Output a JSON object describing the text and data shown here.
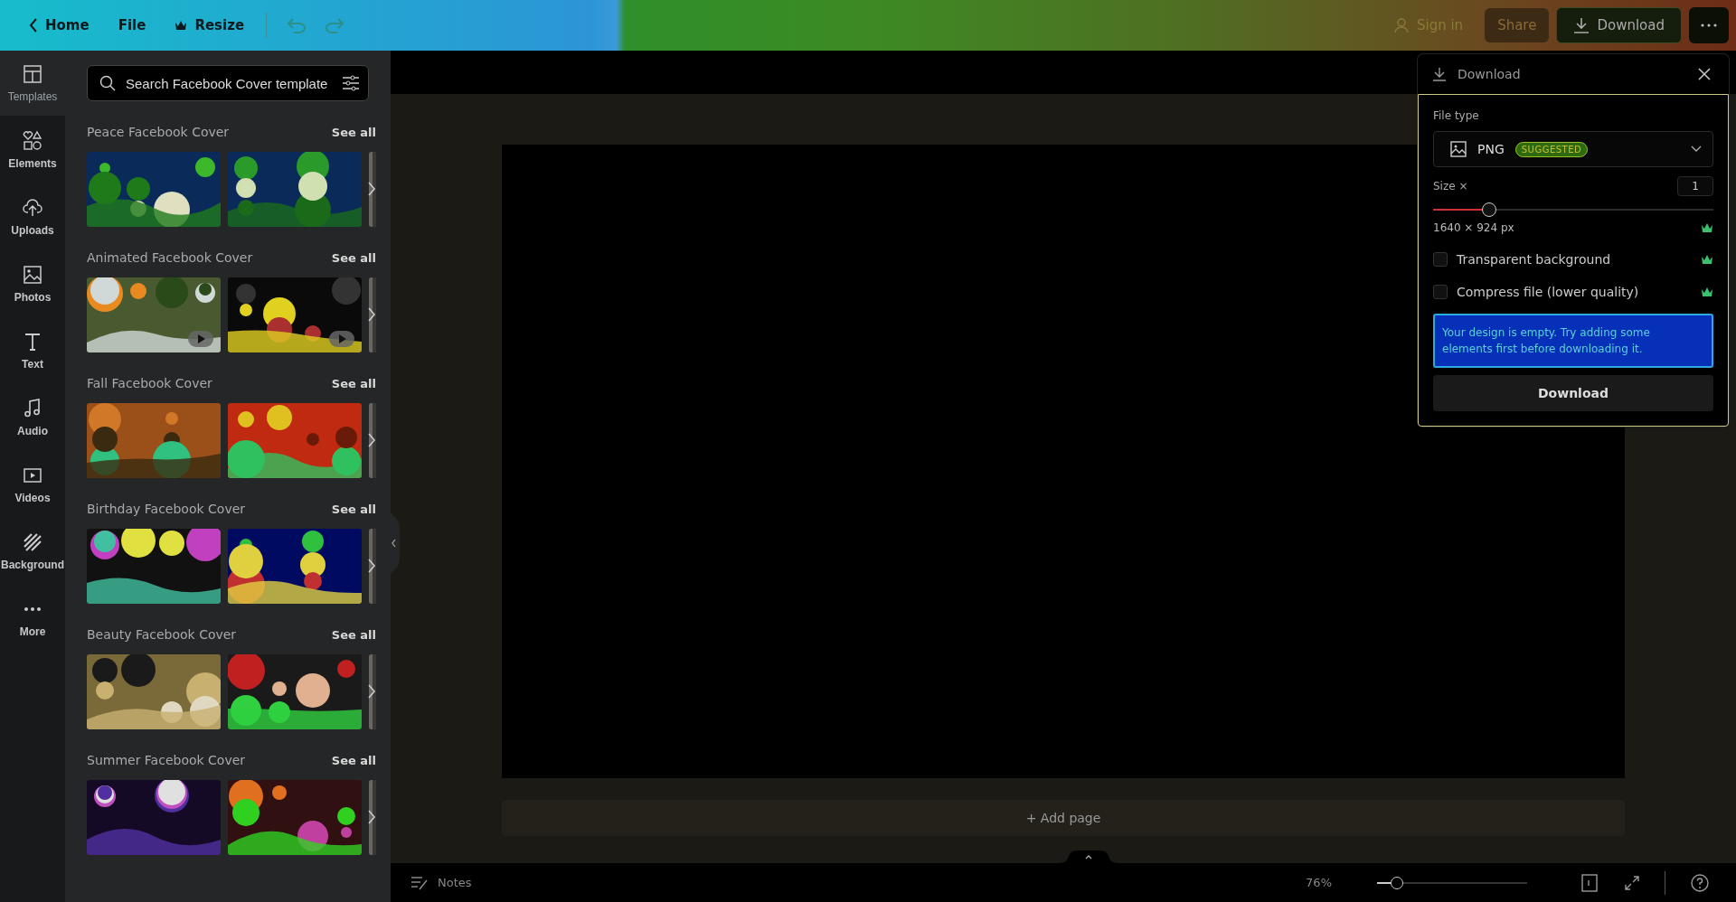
{
  "top_bar": {
    "home": "Home",
    "file": "File",
    "resize": "Resize",
    "sign_in": "Sign in",
    "share": "Share",
    "download": "Download"
  },
  "rail": [
    {
      "label": "Templates",
      "selected": true
    },
    {
      "label": "Elements",
      "selected": false
    },
    {
      "label": "Uploads",
      "selected": false
    },
    {
      "label": "Photos",
      "selected": false
    },
    {
      "label": "Text",
      "selected": false
    },
    {
      "label": "Audio",
      "selected": false
    },
    {
      "label": "Videos",
      "selected": false
    },
    {
      "label": "Background",
      "selected": false
    },
    {
      "label": "More",
      "selected": false
    }
  ],
  "panel": {
    "search_placeholder": "Search Facebook Cover template",
    "sections": [
      {
        "title": "Peace Facebook Cover",
        "see_all": "See all",
        "thumbnails": [
          {
            "kind": "picture",
            "playable": false
          },
          {
            "kind": "picture",
            "playable": false
          },
          {
            "kind": "picture"
          }
        ]
      },
      {
        "title": "Animated Facebook Cover",
        "see_all": "See all",
        "thumbnails": [
          {
            "kind": "picture",
            "playable": true
          },
          {
            "kind": "picture",
            "playable": true
          },
          {
            "kind": "picture"
          }
        ]
      },
      {
        "title": "Fall Facebook Cover",
        "see_all": "See all",
        "thumbnails": [
          {
            "kind": "picture",
            "playable": false
          },
          {
            "kind": "picture",
            "playable": false
          },
          {
            "kind": "picture"
          }
        ]
      },
      {
        "title": "Birthday Facebook Cover",
        "see_all": "See all",
        "thumbnails": [
          {
            "kind": "picture",
            "playable": false
          },
          {
            "kind": "picture",
            "playable": false
          },
          {
            "kind": "picture"
          }
        ]
      },
      {
        "title": "Beauty Facebook Cover",
        "see_all": "See all",
        "thumbnails": [
          {
            "kind": "picture",
            "playable": false
          },
          {
            "kind": "picture",
            "playable": false
          },
          {
            "kind": "picture"
          }
        ]
      },
      {
        "title": "Summer Facebook Cover",
        "see_all": "See all",
        "thumbnails": [
          {
            "kind": "picture",
            "playable": false
          },
          {
            "kind": "picture",
            "playable": false
          },
          {
            "kind": "picture"
          }
        ]
      }
    ]
  },
  "canvas": {
    "add_page": "+ Add page"
  },
  "download_panel": {
    "title": "Download",
    "file_type_label": "File type",
    "file_type": "PNG",
    "badge": "SUGGESTED",
    "size_label": "Size ×",
    "size_value": "1",
    "size_slider": {
      "level": 0.2
    },
    "dimensions": "1640 × 924 px",
    "options": [
      {
        "label": "Transparent background",
        "checked": false
      },
      {
        "label": "Compress file (lower quality)",
        "checked": false
      }
    ],
    "notice": "Your design is empty. Try adding some elements first before downloading it.",
    "button": "Download"
  },
  "status_bar": {
    "notes": "Notes",
    "zoom": "76%",
    "zoom_slider": {
      "level": 0.13
    }
  }
}
